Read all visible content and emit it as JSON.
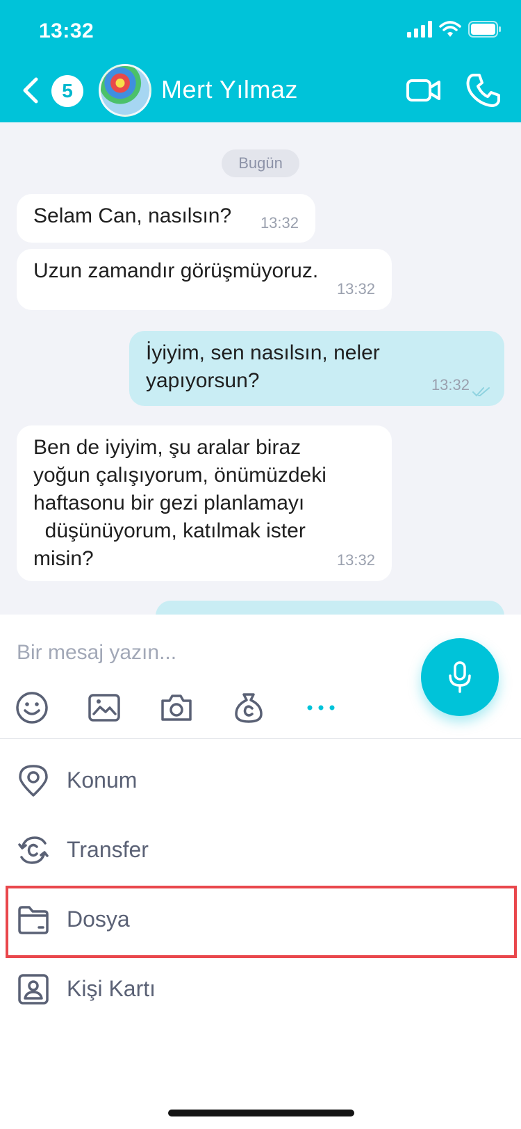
{
  "status_bar": {
    "time": "13:32"
  },
  "header": {
    "unread_count": "5",
    "contact_name": "Mert Yılmaz"
  },
  "chat": {
    "date_label": "Bugün",
    "messages": [
      {
        "direction": "in",
        "text": "Selam Can, nasılsın?",
        "time": "13:32"
      },
      {
        "direction": "in",
        "text": "Uzun zamandır görüşmüyoruz.",
        "time": "13:32"
      },
      {
        "direction": "out",
        "text": "İyiyim, sen nasılsın, neler\nyapıyorsun?",
        "time": "13:32",
        "status": "read"
      },
      {
        "direction": "in",
        "text": "Ben de iyiyim, şu aralar biraz\nyoğun çalışıyorum, önümüzdeki\nhaftasonu bir gezi planlamayı\n  düşünüyorum, katılmak ister\nmisin?",
        "time": "13:32"
      }
    ]
  },
  "composer": {
    "placeholder": "Bir mesaj yazın...",
    "tools": [
      "emoji-icon",
      "image-icon",
      "camera-icon",
      "money-bag-icon",
      "more-icon"
    ]
  },
  "attach_menu": {
    "items": [
      {
        "label": "Konum",
        "icon": "location-pin-icon"
      },
      {
        "label": "Transfer",
        "icon": "transfer-icon"
      },
      {
        "label": "Dosya",
        "icon": "folder-icon",
        "highlighted": true
      },
      {
        "label": "Kişi Kartı",
        "icon": "contact-card-icon"
      }
    ]
  },
  "colors": {
    "accent": "#00c3d9",
    "chat_background": "#f2f3f8",
    "outgoing_bubble": "#c9edf4",
    "highlight_border": "#e9474c"
  }
}
